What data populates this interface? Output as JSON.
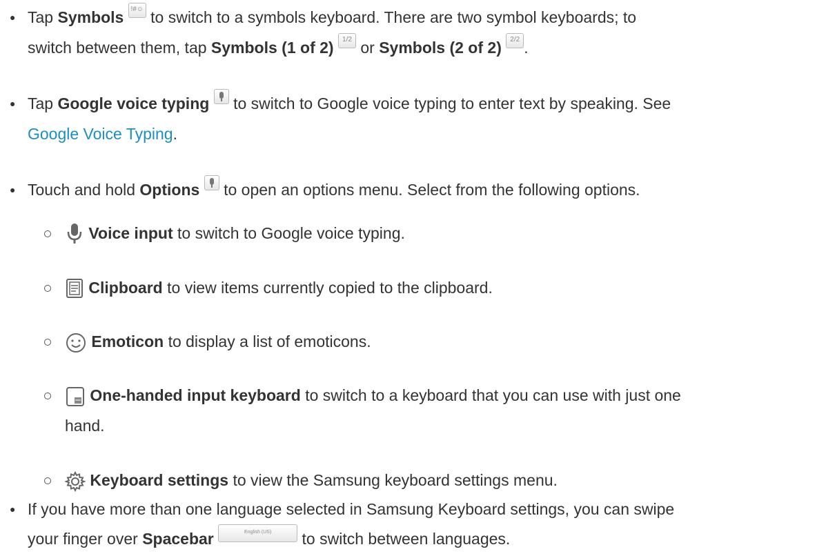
{
  "items": {
    "symbols": {
      "tap": "Tap",
      "name": "Symbols",
      "key_glyph": "!#☺",
      "text1": "to switch to a symbols keyboard. There are two symbol keyboards; to",
      "text2": "switch between them, tap",
      "sym1": "Symbols (1 of 2)",
      "sym1_key": "1/2",
      "or": "or",
      "sym2": "Symbols (2 of 2)",
      "sym2_key": "2/2",
      "end": "."
    },
    "voice": {
      "tap": "Tap",
      "name": "Google voice typing",
      "text1": "to switch to Google voice typing to enter text by speaking. See",
      "link": "Google Voice Typing",
      "end": "."
    },
    "options": {
      "prefix": "Touch and hold",
      "name": "Options",
      "text": "to open an options menu. Select from the following options.",
      "sub": [
        {
          "icon": "microphone-icon",
          "name": "Voice input",
          "text": "to switch to Google voice typing."
        },
        {
          "icon": "clipboard-icon",
          "name": "Clipboard",
          "text": "to view items currently copied to the clipboard."
        },
        {
          "icon": "smiley-icon",
          "name": "Emoticon",
          "text": "to display a list of emoticons."
        },
        {
          "icon": "one-handed-keyboard-icon",
          "name": "One-handed input keyboard",
          "text": "to switch to a keyboard that you can use with just one",
          "text2": "hand."
        },
        {
          "icon": "gear-icon",
          "name": "Keyboard settings",
          "text": "to view the Samsung keyboard settings menu."
        }
      ]
    },
    "spacebar": {
      "text1": "If you have more than one language selected in Samsung Keyboard settings, you can swipe",
      "text2": "your finger over",
      "name": "Spacebar",
      "key_label": "English (US)",
      "end": "to switch between languages."
    }
  },
  "colors": {
    "link": "#1a8fc0",
    "text": "#333333"
  }
}
